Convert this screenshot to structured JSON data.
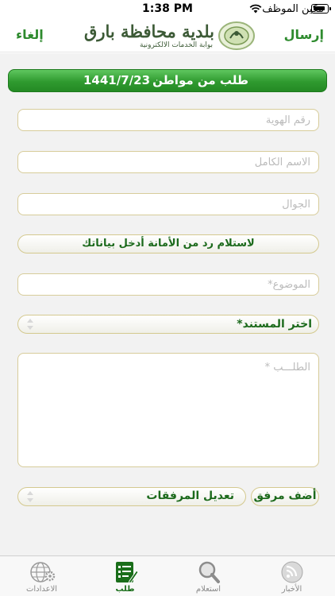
{
  "status_bar": {
    "time": "1:38 PM",
    "carrier": "مكين الموظف"
  },
  "nav": {
    "send_label": "إرسال",
    "cancel_label": "إلغاء",
    "logo_title": "بلدية محافظة بارق",
    "logo_subtitle": "بوابة الخدمات الالكترونية"
  },
  "header": {
    "title": "طلب من مواطن",
    "date": "1441/7/23"
  },
  "form": {
    "id_placeholder": "رقم الهوية",
    "name_placeholder": "الاسم الكامل",
    "mobile_placeholder": "الجوال",
    "receive_reply_label": "لاستلام رد من الأمانة أدخل بياناتك",
    "subject_placeholder": "الموضوع*",
    "document_select_label": "اختر المستند*",
    "request_placeholder": "الطلـــب *",
    "edit_attachments_label": "تعديل المرفقات",
    "add_attachment_label": "أضف مرفق"
  },
  "tabs": [
    {
      "label": "الاعدادات",
      "icon": "settings-globe-icon"
    },
    {
      "label": "طلب",
      "icon": "request-form-icon"
    },
    {
      "label": "استعلام",
      "icon": "magnifier-icon"
    },
    {
      "label": "الأخبار",
      "icon": "rss-news-icon"
    }
  ],
  "colors": {
    "accent_green": "#2f9a2f",
    "field_border": "#d7cc9a",
    "background": "#f2f2f2"
  }
}
